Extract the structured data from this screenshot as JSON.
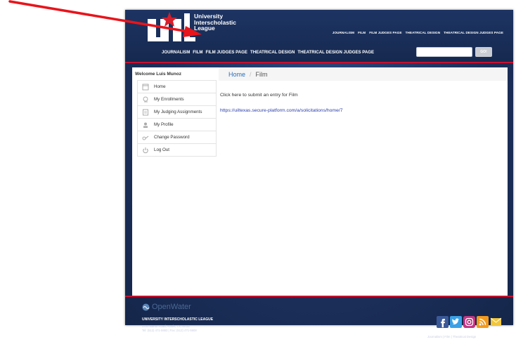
{
  "logo": {
    "org_name": "University\nInterscholastic\nLeague"
  },
  "top_nav": [
    "JOURNALISM",
    "FILM",
    "FILM JUDGES PAGE",
    "THEATRICAL DESIGN",
    "THEATRICAL DESIGN JUDGES PAGE"
  ],
  "main_nav": [
    "JOURNALISM",
    "FILM",
    "FILM JUDGES PAGE",
    "THEATRICAL DESIGN",
    "THEATRICAL DESIGN JUDGES PAGE"
  ],
  "search": {
    "value": "",
    "placeholder": "",
    "go_label": "GO!"
  },
  "sidebar": {
    "welcome": "Welcome Luis Munoz",
    "items": [
      {
        "label": "Home",
        "icon": "home-icon"
      },
      {
        "label": "My Enrollments",
        "icon": "enrollments-icon"
      },
      {
        "label": "My Judging Assignments",
        "icon": "judging-icon"
      },
      {
        "label": "My Profile",
        "icon": "profile-icon"
      },
      {
        "label": "Change Password",
        "icon": "key-icon"
      },
      {
        "label": "Log Out",
        "icon": "power-icon"
      }
    ]
  },
  "breadcrumb": {
    "home": "Home",
    "separator": "/",
    "current": "Film"
  },
  "main": {
    "submit_text": "Click here to submit an entry for Film",
    "link": "https://uiltexas.secure-platform.com/a/solicitations/home/7"
  },
  "footer": {
    "brand": "OpenWater",
    "org": "UNIVERSITY INTERSCHOLASTIC LEAGUE",
    "address": "1701 Manor Road, Austin, TX 78722\nTel: (512) 471-5883 | Fax: (512) 471-5908",
    "links": "Journalism | Film | Theatrical Design",
    "social": [
      "facebook-icon",
      "twitter-icon",
      "instagram-icon",
      "rss-icon",
      "email-icon"
    ]
  },
  "colors": {
    "header_bg": "#1d3463",
    "accent_red": "#c8102e",
    "link_blue": "#2a6ebb",
    "annotation_arrow": "#e8141b"
  }
}
